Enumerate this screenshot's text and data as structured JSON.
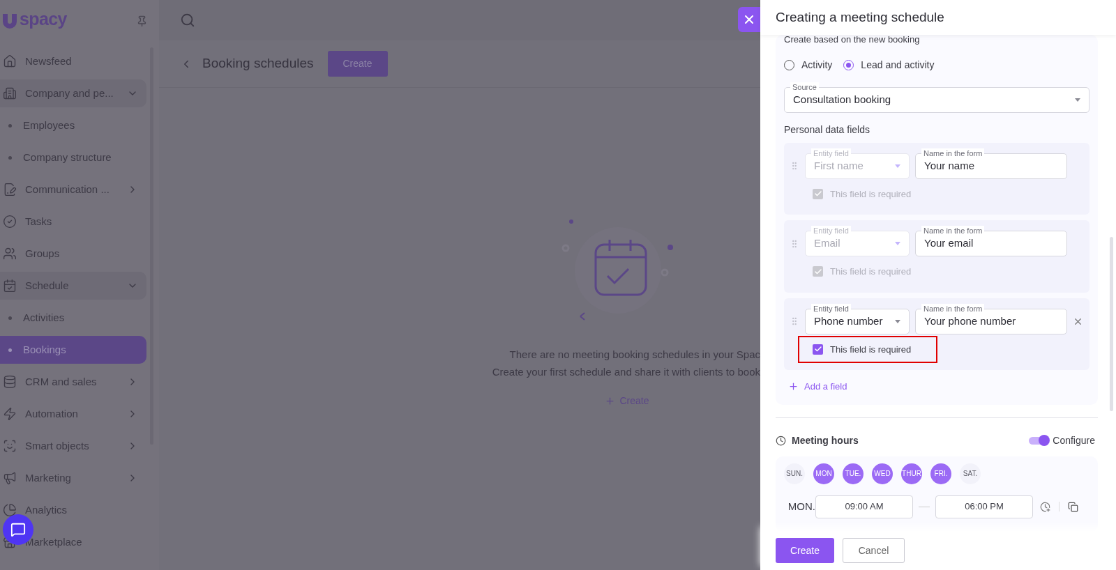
{
  "sidebar": {
    "logo": "spacy",
    "items": [
      {
        "label": "Newsfeed",
        "kind": "link",
        "selected": false
      },
      {
        "label": "Company and pe...",
        "kind": "group",
        "expanded": true,
        "selected": false
      },
      {
        "label": "Employees",
        "kind": "sub",
        "selected": false
      },
      {
        "label": "Company structure",
        "kind": "sub",
        "selected": false
      },
      {
        "label": "Communication ...",
        "kind": "group",
        "expanded": false,
        "selected": false
      },
      {
        "label": "Tasks",
        "kind": "link",
        "selected": false
      },
      {
        "label": "Groups",
        "kind": "link",
        "selected": false
      },
      {
        "label": "Schedule",
        "kind": "group",
        "expanded": true,
        "selected": false
      },
      {
        "label": "Activities",
        "kind": "sub",
        "selected": false
      },
      {
        "label": "Bookings",
        "kind": "sub",
        "selected": true
      },
      {
        "label": "CRM and sales",
        "kind": "group",
        "expanded": false,
        "selected": false
      },
      {
        "label": "Automation",
        "kind": "group",
        "expanded": false,
        "selected": false
      },
      {
        "label": "Smart objects",
        "kind": "group",
        "expanded": false,
        "selected": false
      },
      {
        "label": "Marketing",
        "kind": "group",
        "expanded": false,
        "selected": false
      },
      {
        "label": "Analytics",
        "kind": "link",
        "selected": false
      },
      {
        "label": "Marketplace",
        "kind": "link",
        "selected": false
      }
    ]
  },
  "page": {
    "title": "Booking schedules",
    "create_button": "Create",
    "empty_state": {
      "lines": [
        "There are no meeting booking schedules in your Spac",
        "Create your first schedule and share it with clients to book"
      ],
      "link": "Create"
    }
  },
  "drawer": {
    "title": "Creating a meeting schedule",
    "based_on": "Create based on the new booking",
    "radios": [
      {
        "label": "Activity",
        "selected": false
      },
      {
        "label": "Lead and activity",
        "selected": true
      }
    ],
    "source": {
      "label": "Source",
      "value": "Consultation booking"
    },
    "personal_fields": {
      "title": "Personal data fields",
      "rows": [
        {
          "entity_label": "Entity field",
          "entity_value": "First name",
          "disabled": true,
          "name_label": "Name in the form",
          "name_value": "Your name",
          "required_label": "This field is required",
          "required": true,
          "removable": false,
          "highlighted": false
        },
        {
          "entity_label": "Entity field",
          "entity_value": "Email",
          "disabled": true,
          "name_label": "Name in the form",
          "name_value": "Your email",
          "required_label": "This field is required",
          "required": true,
          "removable": false,
          "highlighted": false
        },
        {
          "entity_label": "Entity field",
          "entity_value": "Phone number",
          "disabled": false,
          "name_label": "Name in the form",
          "name_value": "Your phone number",
          "required_label": "This field is required",
          "required": true,
          "removable": true,
          "highlighted": true
        }
      ],
      "add_label": "Add a field"
    },
    "meeting_hours": {
      "title": "Meeting hours",
      "configure": {
        "label": "Configure",
        "on": true
      },
      "days": [
        {
          "label": "SUN.",
          "selected": false
        },
        {
          "label": "MON",
          "selected": true
        },
        {
          "label": "TUE.",
          "selected": true
        },
        {
          "label": "WED",
          "selected": true
        },
        {
          "label": "THUR",
          "selected": true
        },
        {
          "label": "FRI.",
          "selected": true
        },
        {
          "label": "SAT.",
          "selected": false
        }
      ],
      "hours": [
        {
          "day": "MON.",
          "from": "09:00 AM",
          "to": "06:00 PM"
        }
      ]
    },
    "buttons": [
      {
        "label": "Create",
        "kind": "primary"
      },
      {
        "label": "Cancel",
        "kind": "secondary"
      }
    ]
  }
}
